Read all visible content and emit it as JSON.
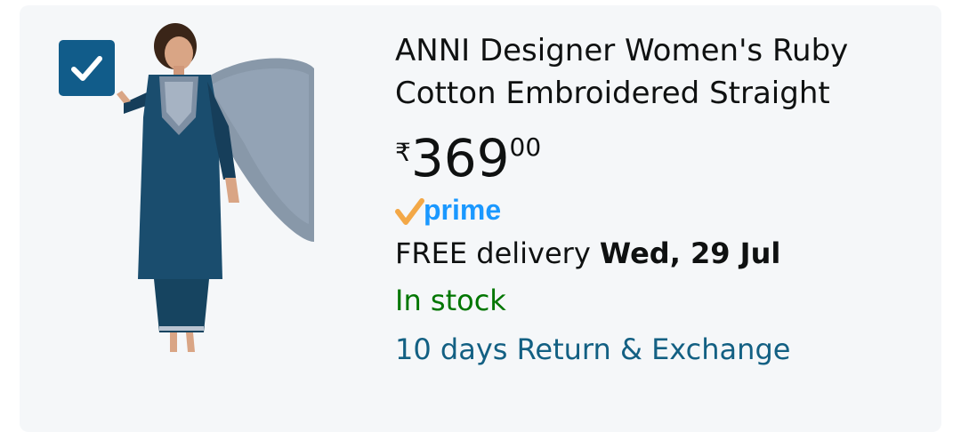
{
  "product": {
    "title": "ANNI Designer Women's Ruby Cotton Embroidered Straight",
    "selected": true,
    "price": {
      "symbol": "₹",
      "whole": "369",
      "fraction": "00"
    },
    "prime_label": "prime",
    "delivery": {
      "prefix": "FREE delivery",
      "date": "Wed, 29 Jul"
    },
    "stock": "In stock",
    "returns": "10 days Return & Exchange"
  },
  "colors": {
    "checkbox": "#115c8a",
    "prime_blue": "#1a98ff",
    "prime_check": "#f3a847",
    "stock_green": "#007600",
    "link_blue": "#136083"
  }
}
